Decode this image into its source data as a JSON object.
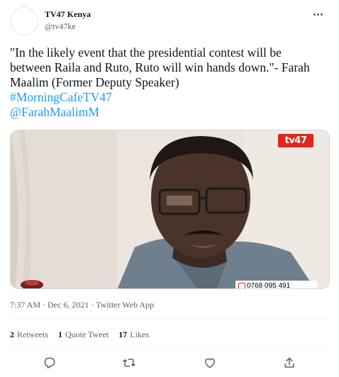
{
  "account": {
    "display_name": "TV47 Kenya",
    "handle": "@tv47ke"
  },
  "tweet": {
    "text_lines": [
      "\"In the likely event that the presidential contest will be",
      "between Raila and Ruto, Ruto will win hands down.\"- Farah",
      "Maalim (Former Deputy Speaker)"
    ],
    "hashtag": "#MorningCafeTV47",
    "mention": "@FarahMaalimM"
  },
  "media": {
    "channel_logo": "tv47",
    "phone_number": "0768 095 491"
  },
  "meta": {
    "time": "7:37 AM",
    "separator1": " · ",
    "date": "Dec 6, 2021",
    "separator2": " · ",
    "source": "Twitter Web App"
  },
  "stats": {
    "retweets_count": "2",
    "retweets_label": "Retweets",
    "quotes_count": "1",
    "quotes_label": "Quote Tweet",
    "likes_count": "17",
    "likes_label": "Likes"
  },
  "icons": [
    "more-icon",
    "reply-icon",
    "retweet-icon",
    "like-icon",
    "share-icon",
    "phone-icon"
  ],
  "colors": {
    "link": "#1d9bf0",
    "secondary_text": "#536471",
    "logo_red": "#e1261c"
  }
}
